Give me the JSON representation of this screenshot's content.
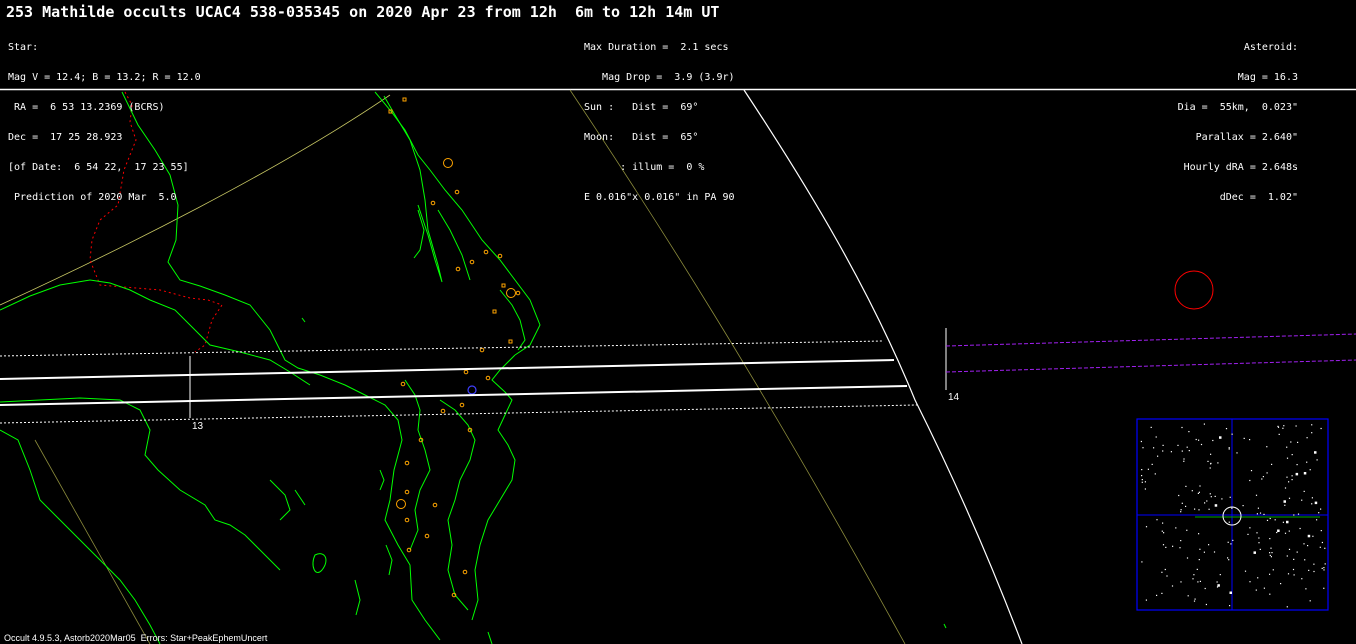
{
  "header": {
    "title": "253 Mathilde occults UCAC4 538-035345 on 2020 Apr 23 from 12h  6m to 12h 14m UT",
    "star_lines": [
      "Star:",
      "Mag V = 12.4; B = 13.2; R = 12.0",
      " RA =  6 53 13.2369 (BCRS)",
      "Dec =  17 25 28.923",
      "[of Date:  6 54 22,  17 23 55]",
      " Prediction of 2020 Mar  5.0"
    ],
    "event_lines": [
      "Max Duration =  2.1 secs",
      "   Mag Drop =  3.9 (3.9r)",
      "Sun :   Dist =  69°",
      "Moon:   Dist =  65°",
      "      : illum =  0 %",
      "E 0.016\"x 0.016\" in PA 90"
    ],
    "asteroid_lines": [
      "Asteroid:",
      "Mag = 16.3",
      "Dia =  55km,  0.023\"",
      "Parallax = 2.640\"",
      "Hourly dRA = 2.648s",
      "dDec =  1.02\""
    ]
  },
  "map": {
    "time_labels": [
      "13",
      "14"
    ],
    "colors": {
      "background": "#000000",
      "coastline": "#00ff00",
      "border": "#ff0000",
      "path_lines": "#ffffff",
      "sites": "#ffa500",
      "twilight_curve": "#c8c864",
      "grid_line": "#8c8c3c",
      "offset_lines": "#a020f0",
      "starfield_frame": "#0000ff"
    }
  },
  "footer": {
    "text": "Occult 4.9.5.3, Astorb2020Mar05  Errors: Star+PeakEphemUncert"
  }
}
